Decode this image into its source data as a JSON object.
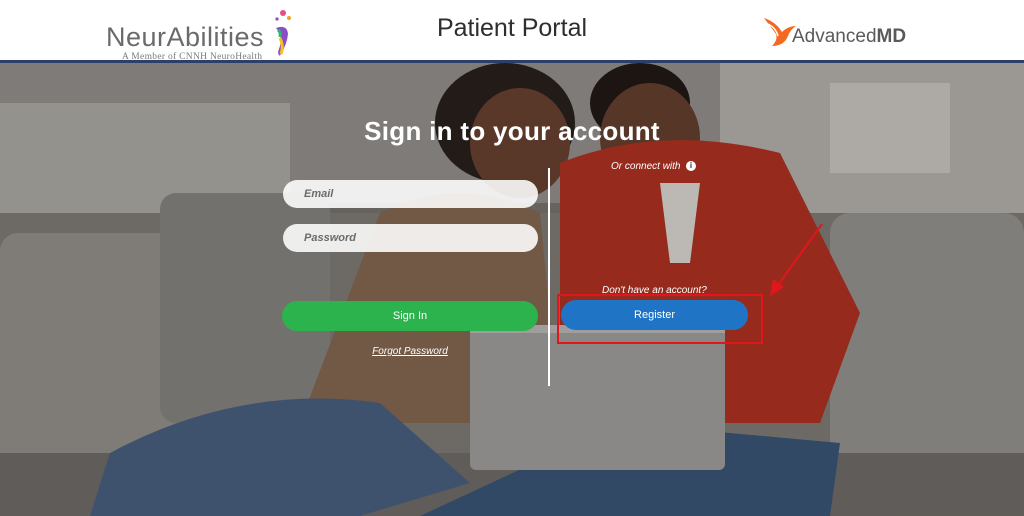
{
  "header": {
    "brand_name": "NeurAbilities",
    "brand_subtitle": "A Member of CNNH NeuroHealth",
    "portal_title": "Patient Portal",
    "partner_name_light": "Advanced",
    "partner_name_bold": "MD",
    "partner_accent_color": "#f26a21"
  },
  "login": {
    "title": "Sign in to your account",
    "email_placeholder": "Email",
    "password_placeholder": "Password",
    "signin_label": "Sign In",
    "forgot_password": "Forgot Password",
    "signin_color": "#2db34d"
  },
  "register_panel": {
    "connect_text": "Or connect with",
    "no_account_text": "Don't have an account?",
    "register_label": "Register",
    "register_color": "#1f74c6"
  },
  "annotation": {
    "highlight_color": "#e0161c",
    "icon": "arrow-icon"
  }
}
